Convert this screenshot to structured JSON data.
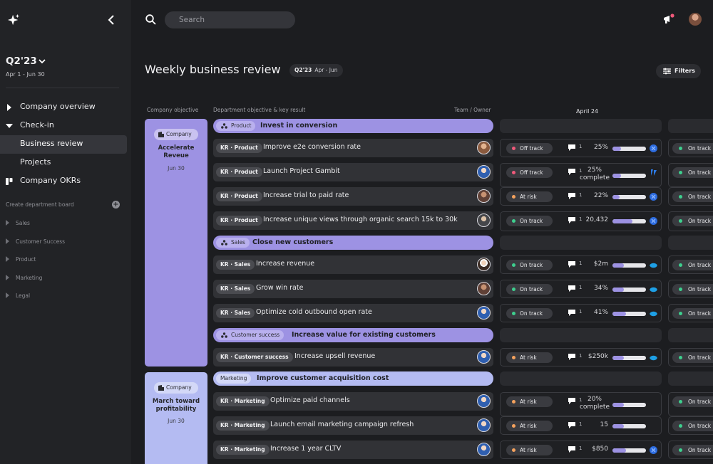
{
  "sidebar": {
    "quarter": "Q2'23",
    "quarter_dates": "Apr 1 - Jun 30",
    "nav": [
      {
        "label": "Company overview",
        "icon": "caret-right-icon"
      },
      {
        "label": "Check-in",
        "icon": "caret-down-icon"
      },
      {
        "label": "Business review",
        "icon": "",
        "active": true
      },
      {
        "label": "Projects",
        "icon": ""
      },
      {
        "label": "Company OKRs",
        "icon": "board-icon"
      }
    ],
    "create_board": "Create department board",
    "departments": [
      "Sales",
      "Customer Success",
      "Product",
      "Marketing",
      "Legal"
    ]
  },
  "topbar": {
    "search_placeholder": "Search"
  },
  "header": {
    "title": "Weekly business review",
    "quarter_badge": "Q2'23",
    "quarter_range": "Apr - Jun",
    "filters_label": "Filters"
  },
  "columns": {
    "company_objective": "Company objective",
    "department_objective": "Department objective & key result",
    "team_owner": "Team / Owner",
    "week": "April 24"
  },
  "company_objectives": [
    {
      "badge": "Company",
      "title": "Accelerate Reveue",
      "date": "Jun 30"
    },
    {
      "badge": "Company",
      "title": "March toward profitability",
      "date": "Jun 30"
    }
  ],
  "dept_objectives": [
    {
      "chip": "Product",
      "title": "Invest in conversion"
    },
    {
      "chip": "Sales",
      "title": "Close new customers"
    },
    {
      "chip": "Customer success",
      "title": "Increase value for existing customers"
    },
    {
      "chip": "Marketing",
      "title": "Improve customer acquisition cost"
    }
  ],
  "key_results": [
    {
      "chip": "KR · Product",
      "title": "Improve e2e conversion rate",
      "status": "Off track",
      "comments": "1",
      "value": "25%",
      "progress": 0.25,
      "tool": "jira-icon",
      "next_status": "On track"
    },
    {
      "chip": "KR · Product",
      "title": "Launch Project Gambit",
      "status": "Off track",
      "comments": "1",
      "value": "25%",
      "value2": "complete",
      "progress": 0.25,
      "tool": "sparkle-blue-icon",
      "next_status": "On track"
    },
    {
      "chip": "KR · Product",
      "title": "Increase trial to paid rate",
      "status": "At risk",
      "comments": "1",
      "value": "22%",
      "progress": 0.22,
      "tool": "jira-icon",
      "next_status": "On track"
    },
    {
      "chip": "KR · Product",
      "title": "Increase unique views through organic search 15k to 30k",
      "status": "On track",
      "comments": "1",
      "value": "20,432",
      "progress": 0.6,
      "tool": "jira-icon",
      "next_status": "On track"
    },
    {
      "chip": "KR · Sales",
      "title": "Increase revenue",
      "status": "On track",
      "comments": "1",
      "value": "$2m",
      "progress": 0.35,
      "tool": "salesforce-icon",
      "next_status": "On track"
    },
    {
      "chip": "KR · Sales",
      "title": "Grow win rate",
      "status": "On track",
      "comments": "1",
      "value": "34%",
      "progress": 0.34,
      "tool": "salesforce-icon",
      "next_status": "On track"
    },
    {
      "chip": "KR · Sales",
      "title": "Optimize cold outbound open rate",
      "status": "On track",
      "comments": "1",
      "value": "41%",
      "progress": 0.4,
      "tool": "salesforce-icon",
      "next_status": "On track"
    },
    {
      "chip": "KR · Customer success",
      "title": "Increase upsell revenue",
      "status": "At risk",
      "comments": "1",
      "value": "$250k",
      "progress": 0.35,
      "tool": "salesforce-icon",
      "next_status": "On track"
    },
    {
      "chip": "KR · Marketing",
      "title": "Optimize paid channels",
      "status": "At risk",
      "comments": "1",
      "value": "20%",
      "value2": "complete",
      "progress": 0.35,
      "tool": "",
      "next_status": "On track"
    },
    {
      "chip": "KR · Marketing",
      "title": "Launch email marketing campaign refresh",
      "status": "At risk",
      "comments": "1",
      "value": "15",
      "progress": 0.35,
      "tool": "",
      "next_status": "On track"
    },
    {
      "chip": "KR · Marketing",
      "title": "Increase  1 year CLTV",
      "status": "At risk",
      "comments": "1",
      "value": "$850",
      "progress": 0.4,
      "tool": "jira-icon",
      "next_status": "On track"
    }
  ],
  "colors": {
    "accent": "#9d92e3",
    "accent_light": "#b4bbf2",
    "on_track": "#3ecf8e",
    "off_track": "#f0597a",
    "at_risk": "#f5a25d"
  }
}
